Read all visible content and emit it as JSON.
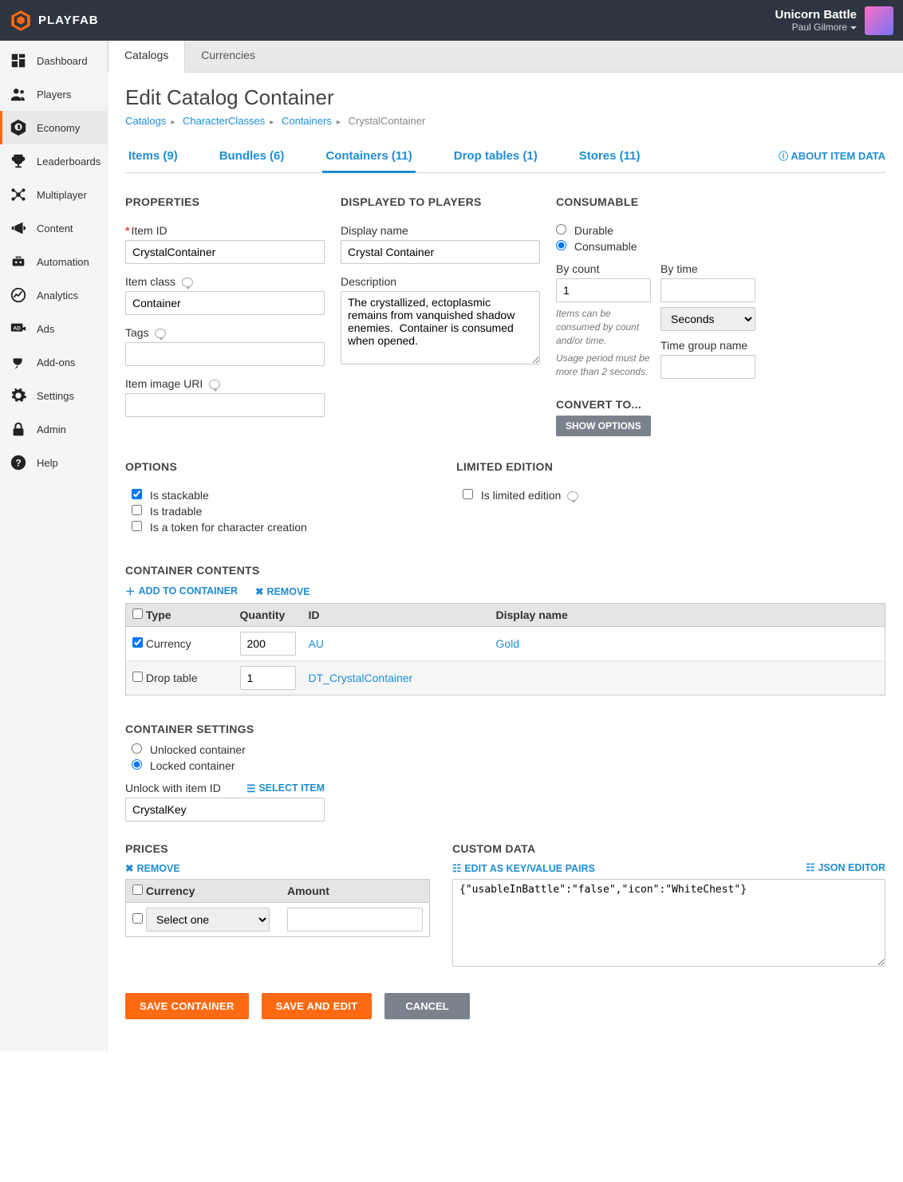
{
  "brand": "PLAYFAB",
  "user": {
    "game": "Unicorn Battle",
    "name": "Paul Gilmore"
  },
  "sidebar": [
    {
      "label": "Dashboard"
    },
    {
      "label": "Players"
    },
    {
      "label": "Economy"
    },
    {
      "label": "Leaderboards"
    },
    {
      "label": "Multiplayer"
    },
    {
      "label": "Content"
    },
    {
      "label": "Automation"
    },
    {
      "label": "Analytics"
    },
    {
      "label": "Ads"
    },
    {
      "label": "Add-ons"
    },
    {
      "label": "Settings"
    },
    {
      "label": "Admin"
    },
    {
      "label": "Help"
    }
  ],
  "subnav": {
    "catalogs": "Catalogs",
    "currencies": "Currencies"
  },
  "page": {
    "title": "Edit Catalog Container"
  },
  "breadcrumb": {
    "a": "Catalogs",
    "b": "CharacterClasses",
    "c": "Containers",
    "d": "CrystalContainer"
  },
  "tabs": {
    "items": "Items (9)",
    "bundles": "Bundles (6)",
    "containers": "Containers (11)",
    "drop": "Drop tables (1)",
    "stores": "Stores (11)",
    "about": "ABOUT ITEM DATA"
  },
  "properties": {
    "heading": "PROPERTIES",
    "item_id_label": "Item ID",
    "item_id": "CrystalContainer",
    "item_class_label": "Item class",
    "item_class": "Container",
    "tags_label": "Tags",
    "tags": "",
    "image_uri_label": "Item image URI",
    "image_uri": ""
  },
  "displayed": {
    "heading": "DISPLAYED TO PLAYERS",
    "display_name_label": "Display name",
    "display_name": "Crystal Container",
    "description_label": "Description",
    "description": "The crystallized, ectoplasmic remains from vanquished shadow enemies.  Container is consumed when opened."
  },
  "consumable": {
    "heading": "CONSUMABLE",
    "durable": "Durable",
    "consumable": "Consumable",
    "by_count_label": "By count",
    "by_count": "1",
    "by_time_label": "By time",
    "by_time": "",
    "by_time_unit": "Seconds",
    "help1": "Items can be consumed by count and/or time.",
    "help2": "Usage period must be more than 2 seconds.",
    "time_group_label": "Time group name",
    "time_group": "",
    "convert_heading": "CONVERT TO...",
    "show_options": "SHOW OPTIONS"
  },
  "options": {
    "heading": "OPTIONS",
    "stackable": "Is stackable",
    "tradable": "Is tradable",
    "token": "Is a token for character creation"
  },
  "limited": {
    "heading": "LIMITED EDITION",
    "label": "Is limited edition"
  },
  "contents": {
    "heading": "CONTAINER CONTENTS",
    "add": "ADD TO CONTAINER",
    "remove": "REMOVE",
    "cols": {
      "type": "Type",
      "qty": "Quantity",
      "id": "ID",
      "dn": "Display name"
    },
    "rows": [
      {
        "type": "Currency",
        "qty": "200",
        "id": "AU",
        "dn": "Gold"
      },
      {
        "type": "Drop table",
        "qty": "1",
        "id": "DT_CrystalContainer",
        "dn": ""
      }
    ]
  },
  "settings": {
    "heading": "CONTAINER SETTINGS",
    "unlocked": "Unlocked container",
    "locked": "Locked container",
    "unlock_label": "Unlock with item ID",
    "select_item": "SELECT ITEM",
    "unlock_value": "CrystalKey"
  },
  "prices": {
    "heading": "PRICES",
    "remove": "REMOVE",
    "cols": {
      "cur": "Currency",
      "amt": "Amount"
    },
    "placeholder": "Select one"
  },
  "custom": {
    "heading": "CUSTOM DATA",
    "kv": "EDIT AS KEY/VALUE PAIRS",
    "json": "JSON EDITOR",
    "value": "{\"usableInBattle\":\"false\",\"icon\":\"WhiteChest\"}"
  },
  "actions": {
    "save": "SAVE CONTAINER",
    "save_edit": "SAVE AND EDIT",
    "cancel": "CANCEL"
  }
}
